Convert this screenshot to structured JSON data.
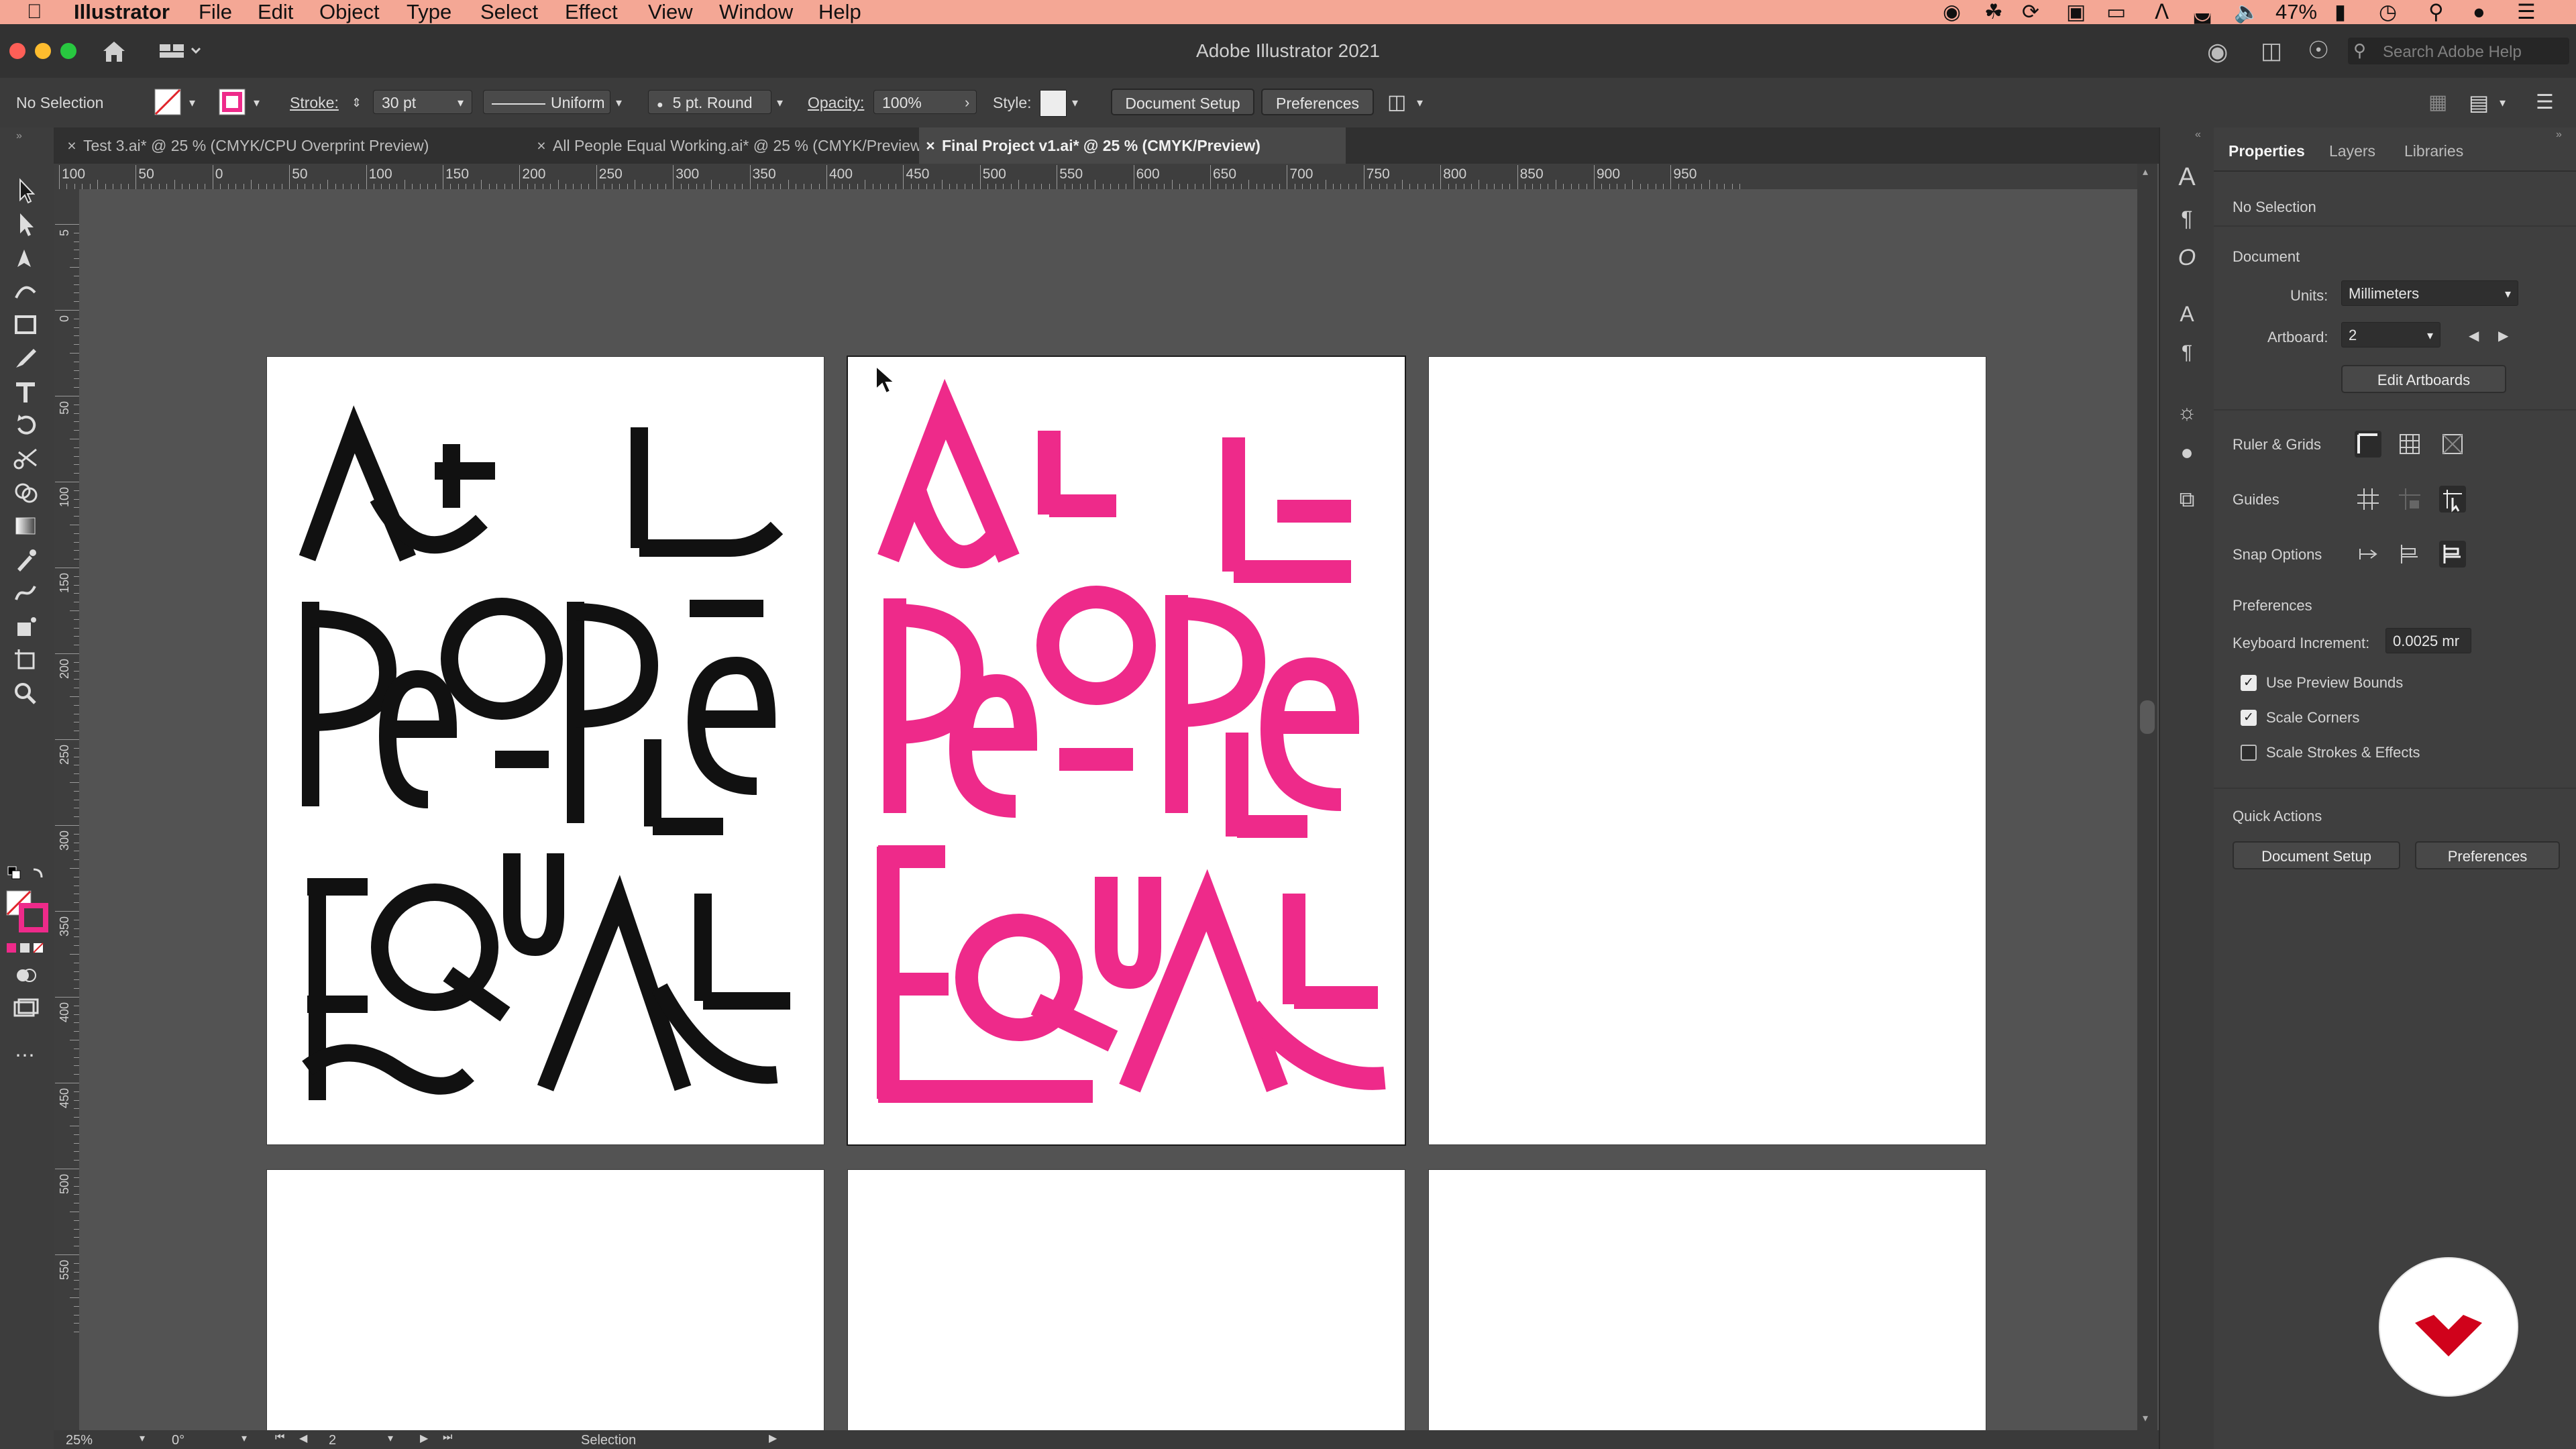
{
  "menubar": {
    "app": "Illustrator",
    "items": [
      "File",
      "Edit",
      "Object",
      "Type",
      "Select",
      "Effect",
      "View",
      "Window",
      "Help"
    ],
    "battery": "47%",
    "background": "#f4a795"
  },
  "window": {
    "title": "Adobe Illustrator 2021",
    "search_placeholder": "Search Adobe Help"
  },
  "controlbar": {
    "selection": "No Selection",
    "stroke_label": "Stroke:",
    "stroke_value": "30 pt",
    "profile": "Uniform",
    "brush": "5 pt. Round",
    "opacity_label": "Opacity:",
    "opacity_value": "100%",
    "style_label": "Style:",
    "document_setup": "Document Setup",
    "preferences": "Preferences"
  },
  "tabs": [
    {
      "label": "Test 3.ai* @ 25 % (CMYK/CPU Overprint Preview)",
      "active": false
    },
    {
      "label": "All People Equal Working.ai* @ 25 % (CMYK/Preview)",
      "active": false
    },
    {
      "label": "Final Project v1.ai* @ 25 % (CMYK/Preview)",
      "active": true
    }
  ],
  "ruler": {
    "h_labels": [
      "100",
      "50",
      "0",
      "50",
      "100",
      "150",
      "200",
      "250",
      "300",
      "350",
      "400",
      "450",
      "500",
      "550",
      "600",
      "650",
      "700",
      "750",
      "800",
      "850",
      "900",
      "950"
    ],
    "v_labels": [
      "5",
      "0",
      "5 0",
      "1 0 0",
      "1 5 0",
      "2 0 0",
      "2 5 0",
      "3 0 0",
      "3 5 0",
      "4 0 0",
      "4 5 0",
      "5 0 0",
      "5 5 0"
    ]
  },
  "artwork": {
    "poster_black": [
      "A",
      "L",
      "L",
      "P",
      "e",
      "O",
      "P",
      "L",
      "e",
      "E",
      "Q",
      "u",
      "A",
      "L"
    ],
    "poster_pink": [
      "A",
      "L",
      "L",
      "P",
      "e",
      "O",
      "P",
      "L",
      "e",
      "E",
      "Q",
      "u",
      "A",
      "L"
    ],
    "pink_color": "#ee2a8a",
    "black_color": "#111111"
  },
  "panel": {
    "tabs": [
      "Properties",
      "Layers",
      "Libraries"
    ],
    "no_selection": "No Selection",
    "document": "Document",
    "units_label": "Units:",
    "units_value": "Millimeters",
    "artboard_label": "Artboard:",
    "artboard_value": "2",
    "edit_artboards": "Edit Artboards",
    "ruler_grids": "Ruler & Grids",
    "guides": "Guides",
    "snap_options": "Snap Options",
    "preferences": "Preferences",
    "keyboard_increment_label": "Keyboard Increment:",
    "keyboard_increment_value": "0.0025 mr",
    "use_preview_bounds": "Use Preview Bounds",
    "scale_corners": "Scale Corners",
    "scale_strokes": "Scale Strokes & Effects",
    "checks": {
      "use_preview_bounds": true,
      "scale_corners": true,
      "scale_strokes": false
    },
    "quick_actions": "Quick Actions",
    "document_setup": "Document Setup",
    "preferences_btn": "Preferences"
  },
  "statusbar": {
    "zoom": "25%",
    "rotation": "0°",
    "artboard": "2",
    "tool": "Selection"
  },
  "logo": {
    "accent": "#d0021b"
  }
}
